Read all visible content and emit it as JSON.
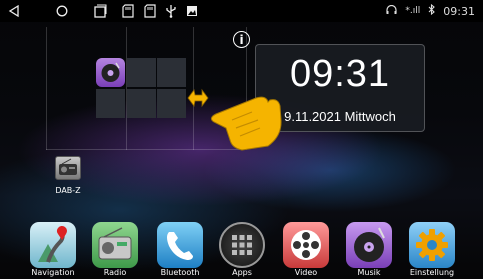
{
  "status_bar": {
    "nav_icons": [
      "back-icon",
      "home-icon",
      "recents-icon",
      "sd-card-icon",
      "sd-card-icon",
      "usb-icon",
      "image-icon"
    ],
    "right_icons": [
      "headset-icon",
      "signal-icon",
      "bluetooth-icon"
    ],
    "signal_text": "*.ıll",
    "time": "09:31"
  },
  "clock_widget": {
    "time": "09:31",
    "date": "9.11.2021  Mittwoch"
  },
  "info_label": "i",
  "desktop_apps": [
    {
      "label": "DAB-Z",
      "icon": "dab-radio-icon"
    }
  ],
  "dock_apps": [
    {
      "label": "Navigation",
      "icon": "navigation-icon"
    },
    {
      "label": "Radio",
      "icon": "radio-icon"
    },
    {
      "label": "Bluetooth",
      "icon": "bluetooth-phone-icon"
    },
    {
      "label": "Apps",
      "icon": "apps-grid-icon"
    },
    {
      "label": "Video",
      "icon": "film-reel-icon"
    },
    {
      "label": "Musik",
      "icon": "music-disc-icon"
    },
    {
      "label": "Einstellung",
      "icon": "settings-gear-icon"
    }
  ],
  "colors": {
    "hand": "#f5b400",
    "accent_purple": "#7a3fb8",
    "status_bg": "#000000"
  }
}
